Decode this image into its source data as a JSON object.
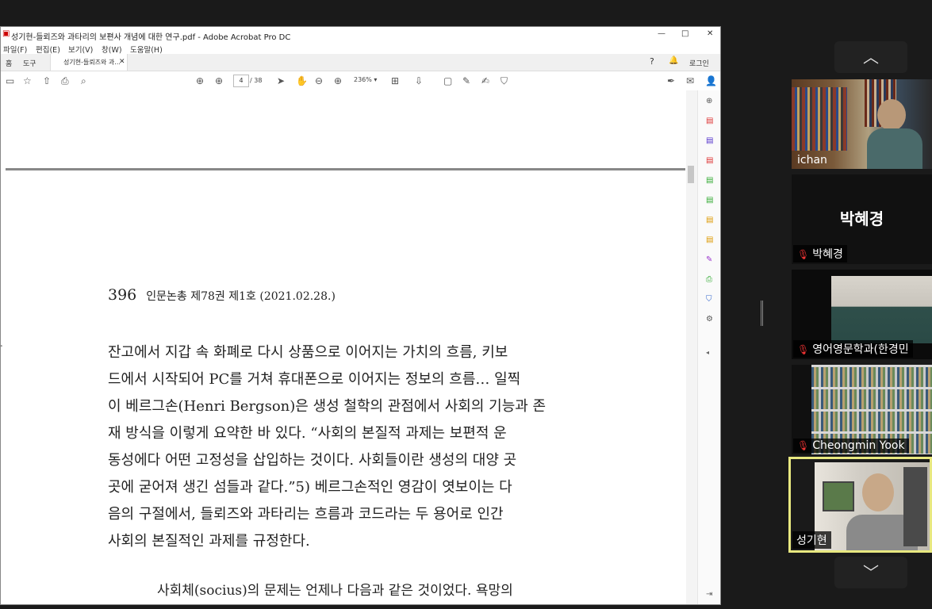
{
  "window": {
    "title": "성기현-들뢰즈와 과타리의 보편사 개념에 대한 연구.pdf - Adobe Acrobat Pro DC"
  },
  "menu": [
    "파일(F)",
    "편집(E)",
    "보기(V)",
    "창(W)",
    "도움말(H)"
  ],
  "tabs": {
    "home": "홈",
    "tools": "도구",
    "doc": "성기현-들뢰즈와 과...",
    "login": "로그인"
  },
  "toolbar": {
    "page_current": "4",
    "page_total": "/ 38",
    "zoom": "236%"
  },
  "document": {
    "page_number": "396",
    "running_head": "인문논총 제78권 제1호 (2021.02.28.)",
    "lines": [
      "잔고에서 지갑 속 화폐로 다시 상품으로 이어지는 가치의 흐름, 키보",
      "드에서 시작되어 PC를 거쳐 휴대폰으로 이어지는 정보의 흐름… 일찍",
      "이 베르그손(Henri Bergson)은 생성 철학의 관점에서 사회의 기능과 존",
      "재 방식을 이렇게 요약한 바 있다. “사회의 본질적 과제는 보편적 운",
      "동성에다 어떤 고정성을 삽입하는 것이다. 사회들이란 생성의 대양 곳",
      "곳에 굳어져 생긴 섬들과 같다.”5) 베르그손적인 영감이 엿보이는 다",
      "음의 구절에서, 들뢰즈와 과타리는 흐름과 코드라는 두 용어로 인간",
      "사회의 본질적인 과제를 규정한다."
    ],
    "quote_line": "사회체(socius)의 문제는 언제나 다음과 같은 것이었다. 욕망의"
  },
  "participants": [
    {
      "name": "ichan",
      "video": true
    },
    {
      "name": "박혜경",
      "video": false,
      "display_name": "박혜경"
    },
    {
      "name": "영어영문학과(한경민",
      "video": true
    },
    {
      "name": "Cheongmin Yook",
      "video": true
    },
    {
      "name": "성기현",
      "video": true,
      "active_speaker": true
    }
  ],
  "colors": {
    "active_speaker_border": "#e8e880",
    "mic_muted": "#e03030",
    "acrobat_red": "#cc0000"
  }
}
